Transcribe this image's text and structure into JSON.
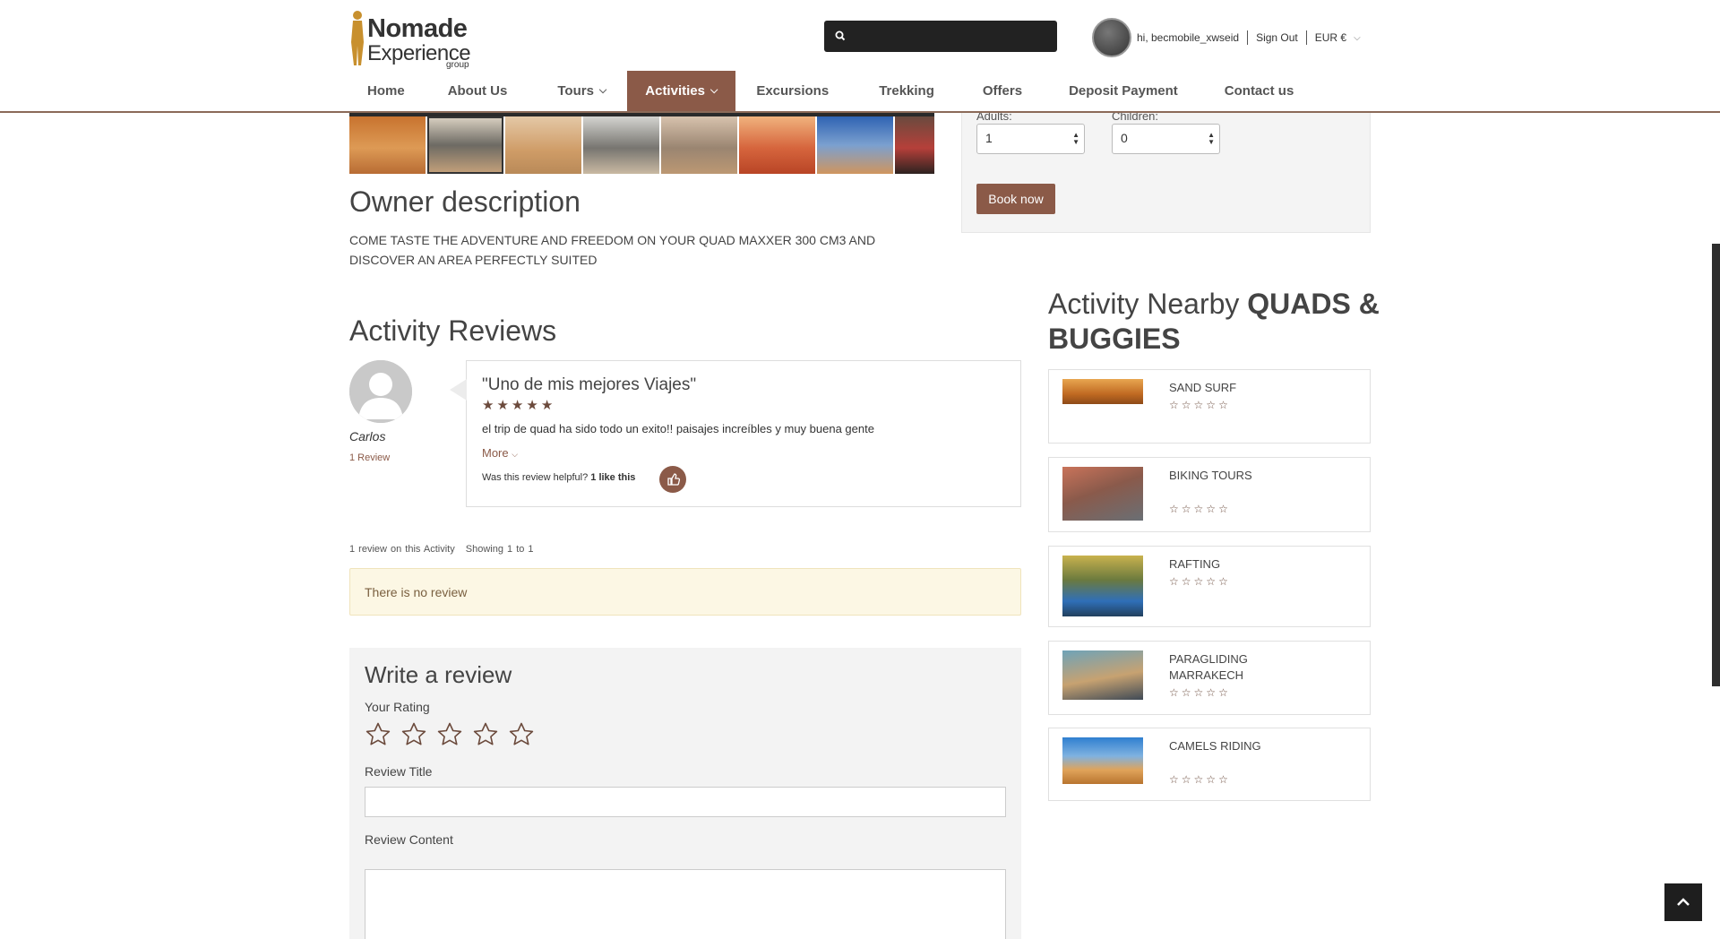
{
  "logo": {
    "line1": "Nomade",
    "line2": "Experience",
    "line3": "group"
  },
  "user": {
    "greeting": "hi, becmobile_xwseid",
    "signout": "Sign Out",
    "currency": "EUR €"
  },
  "nav": [
    {
      "label": "Home",
      "dropdown": false
    },
    {
      "label": "About Us",
      "dropdown": false
    },
    {
      "label": "Tours",
      "dropdown": true
    },
    {
      "label": "Activities",
      "dropdown": true,
      "active": true
    },
    {
      "label": "Excursions",
      "dropdown": false
    },
    {
      "label": "Trekking",
      "dropdown": false
    },
    {
      "label": "Offers",
      "dropdown": false
    },
    {
      "label": "Deposit Payment",
      "dropdown": false
    },
    {
      "label": "Contact us",
      "dropdown": false
    }
  ],
  "booking": {
    "adults_label": "Adults:",
    "adults_value": "1",
    "children_label": "Children:",
    "children_value": "0",
    "book_label": "Book now"
  },
  "owner": {
    "title": "Owner description",
    "text": "COME TASTE THE ADVENTURE AND FREEDOM ON YOUR QUAD MAXXER 300 CM3 AND DISCOVER AN AREA PERFECTLY SUITED"
  },
  "reviews": {
    "title": "Activity Reviews",
    "reviewer_name": "Carlos",
    "reviewer_count": "1 Review",
    "review_title": "\"Uno de mis mejores Viajes\"",
    "review_rating": 5,
    "review_body": "el trip de quad ha sido todo un exito!! paisajes increíbles y muy buena gente",
    "more_label": "More",
    "helpful_text": "Was this review helpful?",
    "helpful_count": "1 like this",
    "summary_count": "1 review on this Activity",
    "summary_showing": "Showing 1 to 1",
    "no_review": "There is no review"
  },
  "write_review": {
    "title": "Write a review",
    "rating_label": "Your Rating",
    "title_label": "Review Title",
    "content_label": "Review Content"
  },
  "nearby": {
    "title_prefix": "Activity Nearby",
    "title_strong": "QUADS & BUGGIES",
    "items": [
      {
        "name": "SAND SURF",
        "rating": 0
      },
      {
        "name": "BIKING TOURS",
        "rating": 0
      },
      {
        "name": "RAFTING",
        "rating": 0
      },
      {
        "name": "PARAGLIDING MARRAKECH",
        "rating": 0
      },
      {
        "name": "CAMELS RIDING",
        "rating": 0
      }
    ]
  },
  "colors": {
    "accent": "#8b5a48",
    "star": "#6b4a3c",
    "notice_bg": "#fcf7e4"
  }
}
